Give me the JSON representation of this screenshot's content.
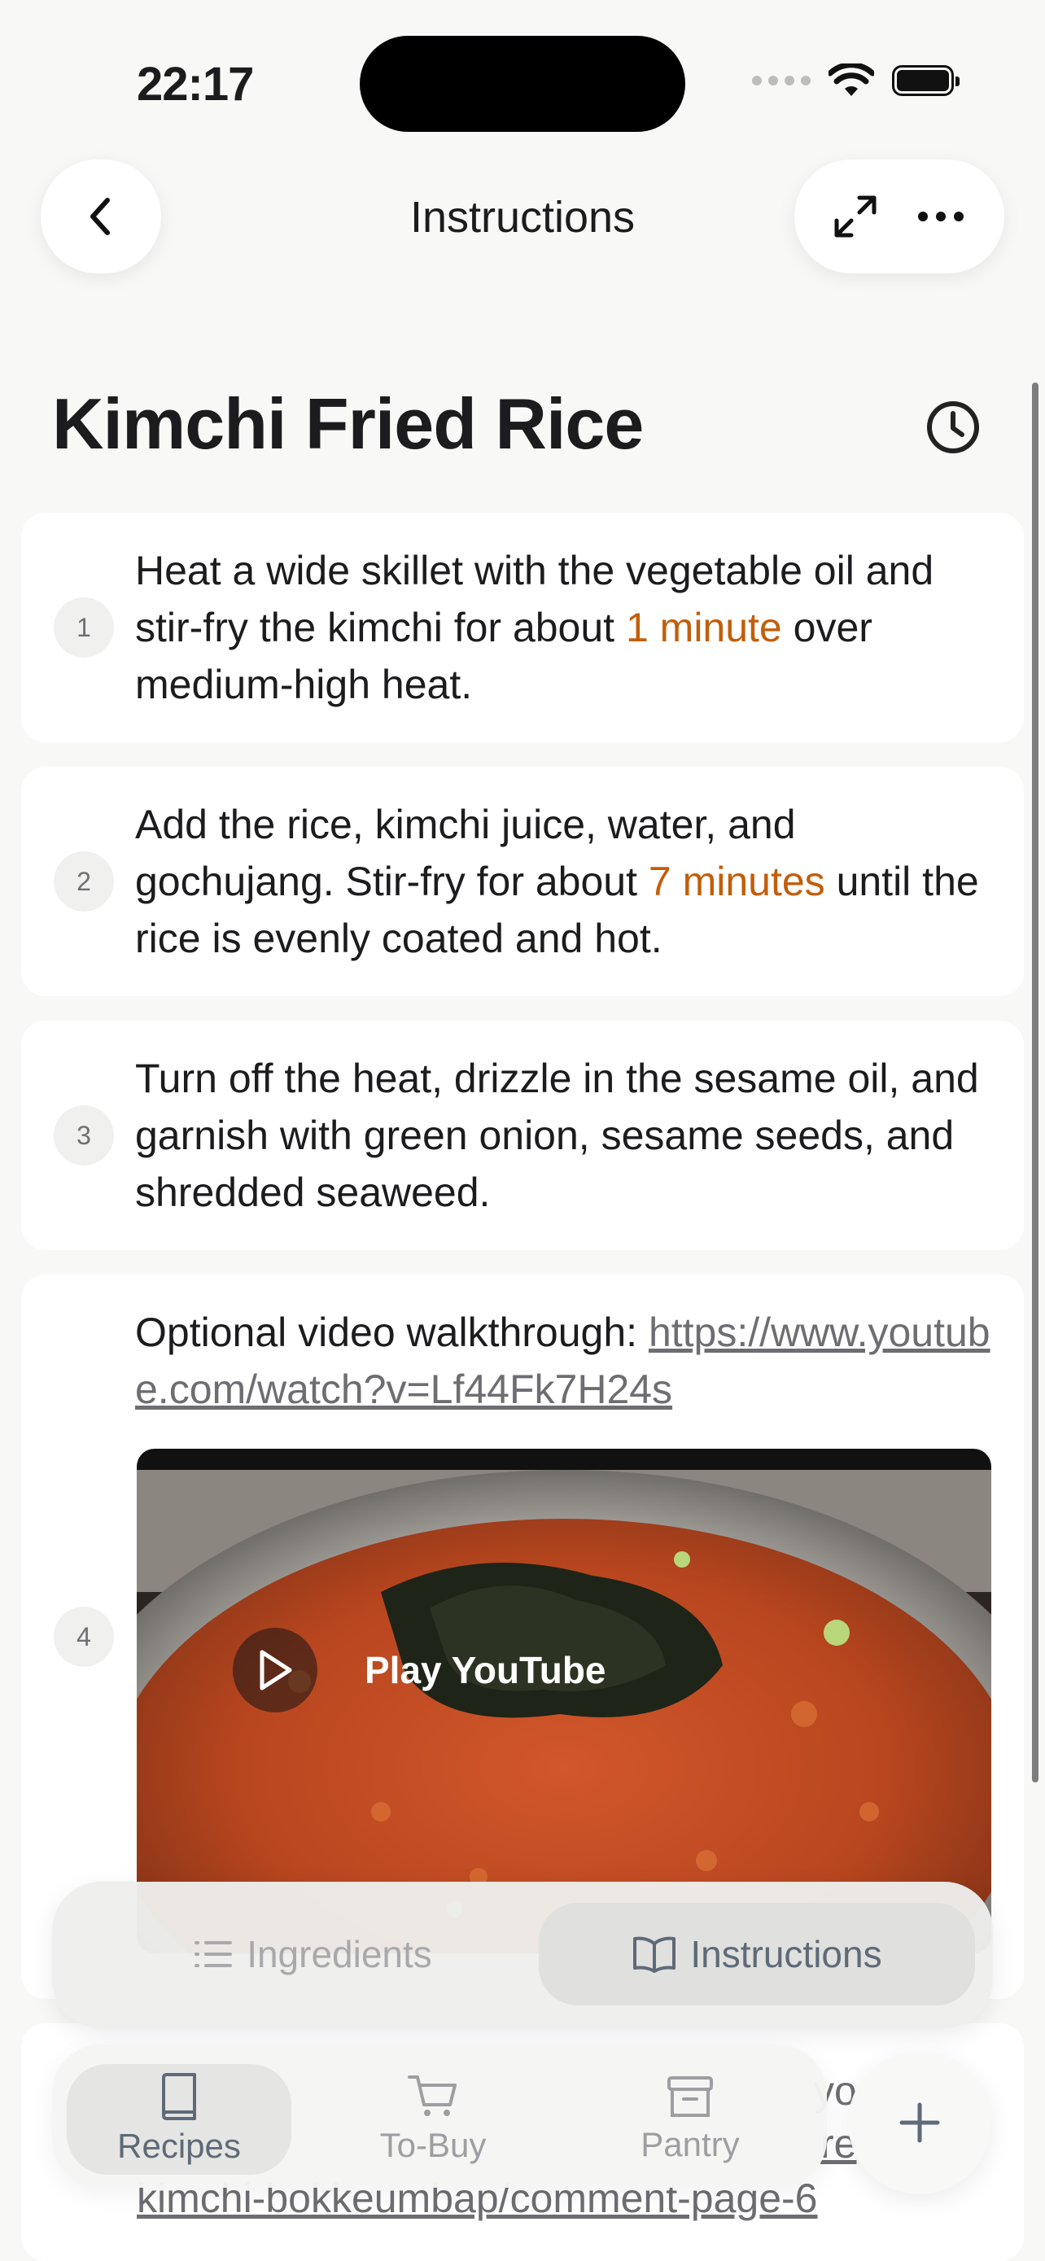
{
  "status_bar": {
    "time": "22:17"
  },
  "nav": {
    "title": "Instructions"
  },
  "recipe": {
    "title": "Kimchi Fried Rice"
  },
  "steps": [
    {
      "number": "1",
      "text_before": "Heat a wide skillet with the vegetable oil and stir-fry the kimchi for about ",
      "highlight": "1 minute",
      "text_after": " over medium-high heat."
    },
    {
      "number": "2",
      "text_before": "Add the rice, kimchi juice, water, and gochujang. Stir-fry for about ",
      "highlight": "7 minutes",
      "text_after": " until the rice is evenly coated and hot."
    },
    {
      "number": "3",
      "text": "Turn off the heat, drizzle in the sesame oil, and garnish with green onion, sesame seeds, and shredded seaweed."
    },
    {
      "number": "4",
      "text_before": "Optional video walkthrough: ",
      "link": "https://www.youtube.com/watch?v=Lf44Fk7H24s",
      "video_label": "Play YouTube"
    }
  ],
  "peek": {
    "link_fragment_1": "yo",
    "link_fragment_2": "re",
    "link_line": "kimchi-bokkeumbap/comment-page-6"
  },
  "segmented": {
    "ingredients": "Ingredients",
    "instructions": "Instructions",
    "selected": "Instructions"
  },
  "tabbar": {
    "recipes": "Recipes",
    "to_buy": "To-Buy",
    "pantry": "Pantry",
    "selected": "Recipes"
  },
  "colors": {
    "highlight": "#c25e0a",
    "accent_selected": "#5e6a78"
  }
}
